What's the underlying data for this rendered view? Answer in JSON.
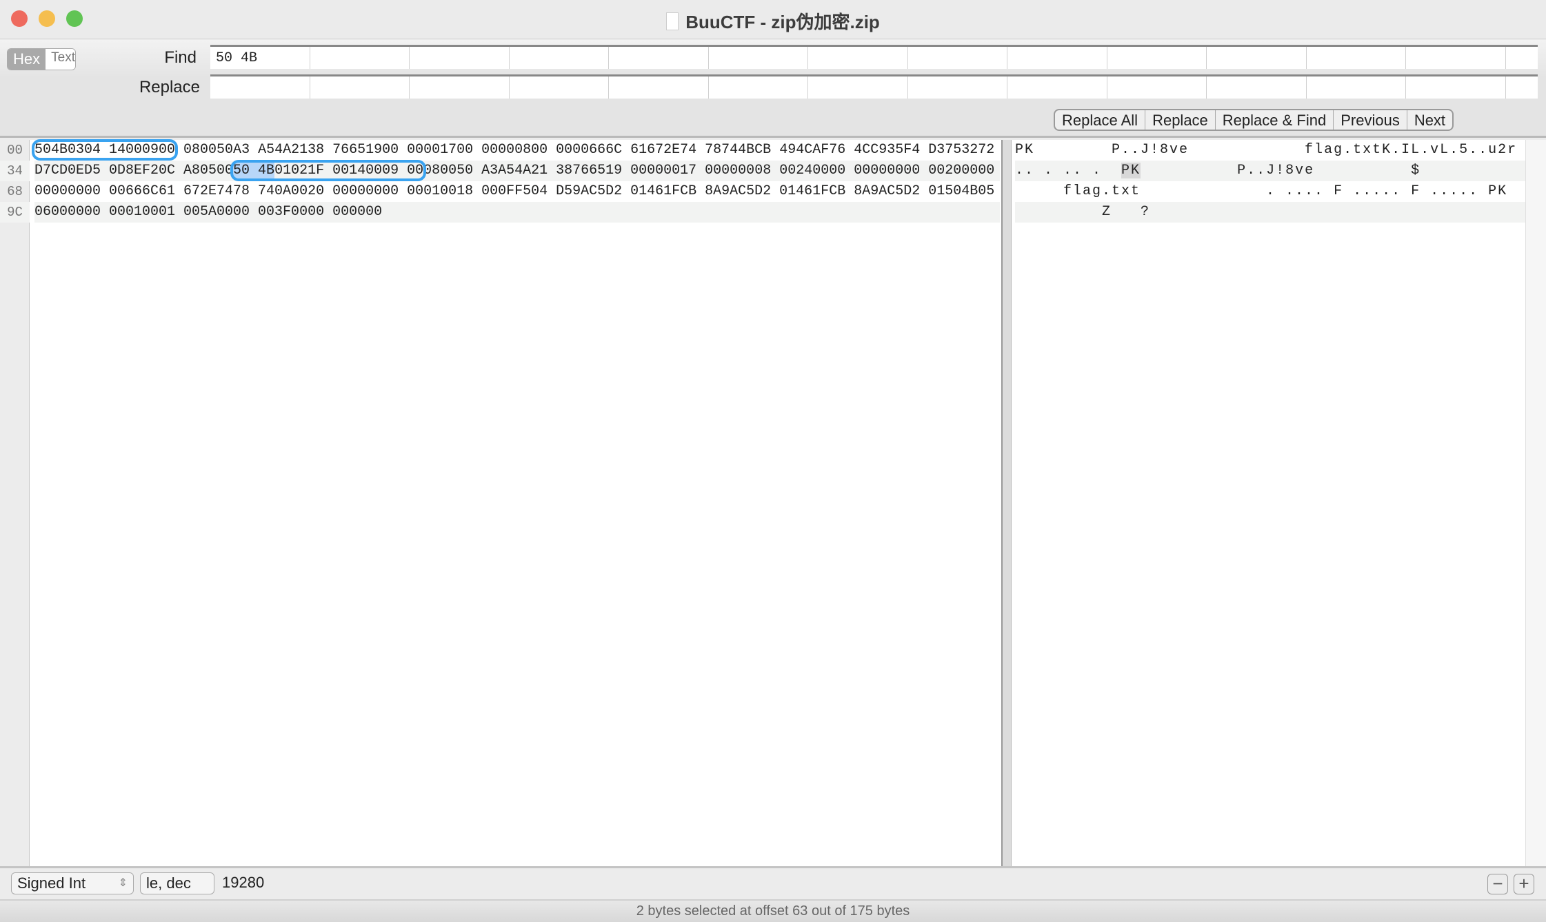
{
  "window": {
    "title": "BuuCTF - zip伪加密.zip",
    "lights": {
      "close": "#ee6a5e",
      "minimize": "#f5be4f",
      "zoom": "#61c454"
    }
  },
  "toolbar": {
    "mode_hex": "Hex",
    "mode_text": "Text",
    "mode_selected": "Hex",
    "find_label": "Find",
    "find_value": "50 4B",
    "replace_label": "Replace",
    "replace_value": "",
    "buttons": [
      "Replace All",
      "Replace",
      "Replace & Find",
      "Previous",
      "Next"
    ]
  },
  "editor": {
    "rows": [
      {
        "offset": "00",
        "hex_pre": "",
        "hex_match": "504B0304 14000900",
        "hex_sel": "",
        "hex_match2": "",
        "hex_post": " 080050A3 A54A2138 76651900 00001700 00000800 0000666C 61672E74 78744BCB 494CAF76 4CC935F4 D3753272",
        "txt_pre": "PK        P..J!8ve            flag.txtK.IL.vL.5..u2r",
        "txt_sel": "",
        "txt_post": ""
      },
      {
        "offset": "34",
        "hex_pre": "D7CD0ED5 0D8EF20C A80500",
        "hex_match": "",
        "hex_sel": "50 4B",
        "hex_match2": "01021F 00140009 00",
        "hex_post": "080050 A3A54A21 38766519 00000017 00000008 00240000 00000000 00200000",
        "txt_pre": ".. . .. .  ",
        "txt_sel": "PK",
        "txt_post": "          P..J!8ve          $"
      },
      {
        "offset": "68",
        "hex_pre": "00000000 00666C61 672E7478 740A0020 00000000 00010018 000FF504 D59AC5D2 01461FCB 8A9AC5D2 01461FCB 8A9AC5D2 01504B05",
        "hex_match": "",
        "hex_sel": "",
        "hex_match2": "",
        "hex_post": "",
        "txt_pre": "     flag.txt             . .... F ..... F ..... PK",
        "txt_sel": "",
        "txt_post": ""
      },
      {
        "offset": "9C",
        "hex_pre": "06000000 00010001 005A0000 003F0000 000000",
        "hex_match": "",
        "hex_sel": "",
        "hex_match2": "",
        "hex_post": "",
        "txt_pre": "         Z   ?",
        "txt_sel": "",
        "txt_post": ""
      }
    ],
    "match_color": "#3aa3f0",
    "selection_color": "#b7d6f8"
  },
  "bottom": {
    "type_select": "Signed Int",
    "format_select": "le, dec",
    "value": "19280",
    "minus": "−",
    "plus": "+"
  },
  "status": "2 bytes selected at offset 63 out of 175 bytes"
}
